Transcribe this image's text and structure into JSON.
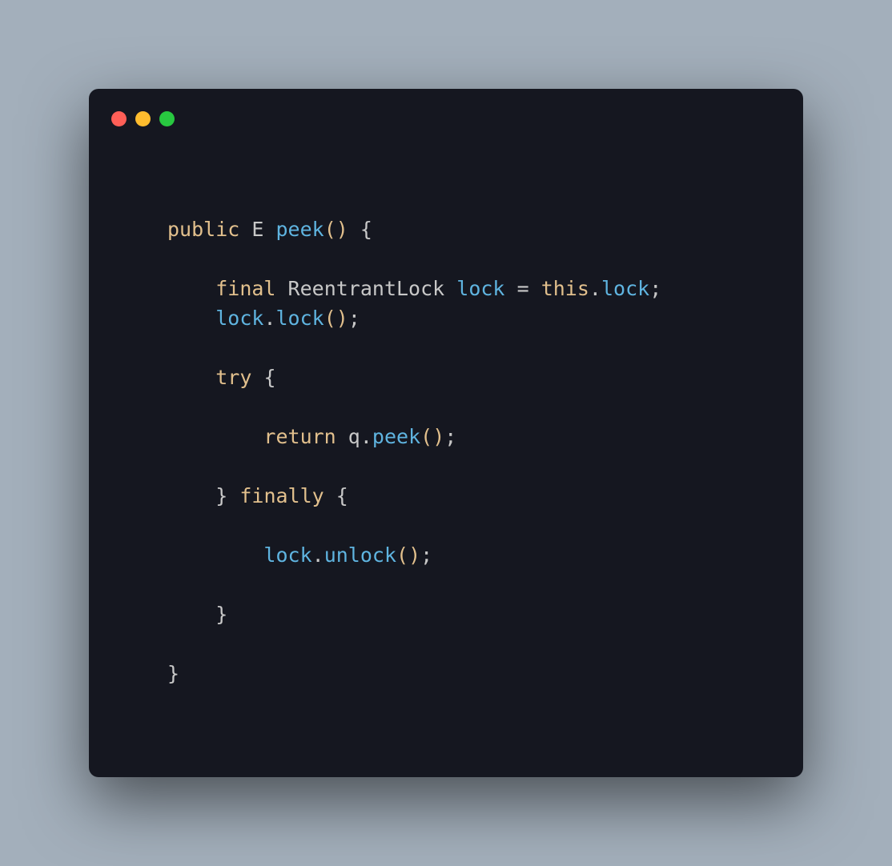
{
  "colors": {
    "bg_page": "#a3afbb",
    "bg_window": "#151720",
    "traffic_red": "#ff5f57",
    "traffic_yellow": "#febc2e",
    "traffic_green": "#28c840",
    "keyword": "#e2c08d",
    "func": "#5fb4e0",
    "default": "#c8c8c8"
  },
  "code": {
    "line1": {
      "kw_public": "public",
      "type_E": "E",
      "fn_peek": "peek",
      "parens": "()",
      "brace_open": "{"
    },
    "line3": {
      "kw_final": "final",
      "type_ReentrantLock": "ReentrantLock",
      "ident_lock": "lock",
      "op_eq": "=",
      "kw_this": "this",
      "dot": ".",
      "prop_lock": "lock",
      "semi": ";"
    },
    "line4": {
      "ident_lock": "lock",
      "dot": ".",
      "fn_lock": "lock",
      "parens": "()",
      "semi": ";"
    },
    "line6": {
      "kw_try": "try",
      "brace_open": "{"
    },
    "line8": {
      "kw_return": "return",
      "ident_q": "q",
      "dot": ".",
      "fn_peek": "peek",
      "parens": "()",
      "semi": ";"
    },
    "line10": {
      "brace_close": "}",
      "kw_finally": "finally",
      "brace_open": "{"
    },
    "line12": {
      "ident_lock": "lock",
      "dot": ".",
      "fn_unlock": "unlock",
      "parens": "()",
      "semi": ";"
    },
    "line14": {
      "brace_close": "}"
    },
    "line16": {
      "brace_close": "}"
    }
  }
}
